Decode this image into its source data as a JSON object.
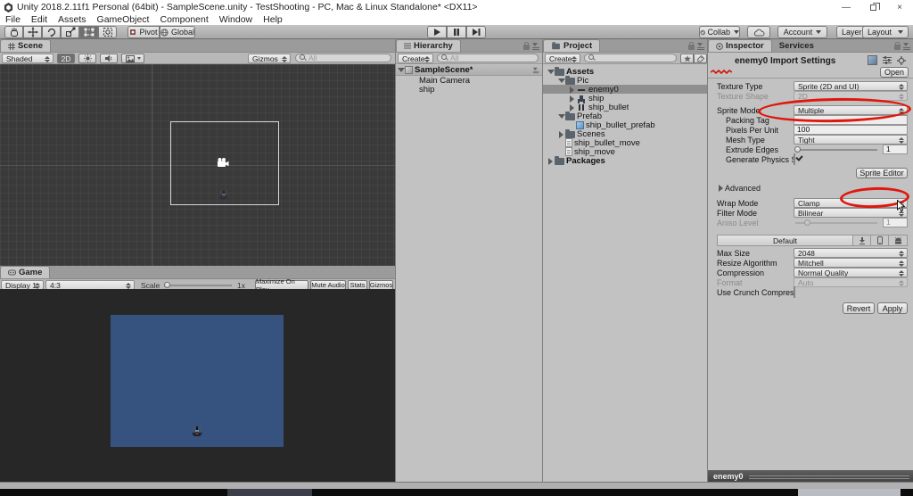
{
  "window": {
    "title": "Unity 2018.2.11f1 Personal (64bit) - SampleScene.unity - TestShooting - PC, Mac & Linux Standalone* <DX11>"
  },
  "menu": {
    "items": [
      "File",
      "Edit",
      "Assets",
      "GameObject",
      "Component",
      "Window",
      "Help"
    ]
  },
  "toolbar": {
    "pivot": "Pivot",
    "global": "Global",
    "collab": "Collab",
    "account": "Account",
    "layers": "Layers",
    "layout": "Layout"
  },
  "scene_view": {
    "tab": "Scene",
    "shading": "Shaded",
    "mode2d": "2D",
    "gizmos": "Gizmos",
    "search_hint": "All"
  },
  "game_view": {
    "tab": "Game",
    "display": "Display 1",
    "aspect": "4:3",
    "scale_label": "Scale",
    "scale_value": "1x",
    "maximize": "Maximize On Play",
    "mute": "Mute Audio",
    "stats": "Stats",
    "gizmos": "Gizmos"
  },
  "hierarchy": {
    "tab": "Hierarchy",
    "create": "Create",
    "search_hint": "All",
    "scene_root": "SampleScene*",
    "items": [
      "Main Camera",
      "ship"
    ]
  },
  "project": {
    "tab": "Project",
    "create": "Create",
    "tree": [
      "Assets",
      "Pic",
      "enemy0",
      "ship",
      "ship_bullet",
      "Prefab",
      "ship_bullet_prefab",
      "Scenes",
      "ship_bullet_move",
      "ship_move",
      "Packages"
    ]
  },
  "inspector": {
    "tab": "Inspector",
    "tab_services": "Services",
    "title": "enemy0 Import Settings",
    "open": "Open",
    "texture_type": {
      "label": "Texture Type",
      "value": "Sprite (2D and UI)"
    },
    "texture_shape": {
      "label": "Texture Shape",
      "value": "2D"
    },
    "sprite_mode": {
      "label": "Sprite Mode",
      "value": "Multiple"
    },
    "packing_tag": {
      "label": "Packing Tag",
      "value": ""
    },
    "pixels_per_unit": {
      "label": "Pixels Per Unit",
      "value": "100"
    },
    "mesh_type": {
      "label": "Mesh Type",
      "value": "Tight"
    },
    "extrude_edges": {
      "label": "Extrude Edges",
      "value": "1"
    },
    "generate_physics": {
      "label": "Generate Physics Sh"
    },
    "sprite_editor": "Sprite Editor",
    "advanced": "Advanced",
    "wrap_mode": {
      "label": "Wrap Mode",
      "value": "Clamp"
    },
    "filter_mode": {
      "label": "Filter Mode",
      "value": "Bilinear"
    },
    "aniso_level": {
      "label": "Aniso Level",
      "value": "1"
    },
    "platform": {
      "default_tab": "Default"
    },
    "max_size": {
      "label": "Max Size",
      "value": "2048"
    },
    "resize_algorithm": {
      "label": "Resize Algorithm",
      "value": "Mitchell"
    },
    "compression": {
      "label": "Compression",
      "value": "Normal Quality"
    },
    "format": {
      "label": "Format",
      "value": "Auto"
    },
    "use_crunch": {
      "label": "Use Crunch Compressi"
    },
    "revert": "Revert",
    "apply": "Apply",
    "preview_bar": "enemy0"
  },
  "colors": {
    "annotation_red": "#df170c",
    "game_bg": "#36527e",
    "scene_bg": "#3a3a3a"
  }
}
